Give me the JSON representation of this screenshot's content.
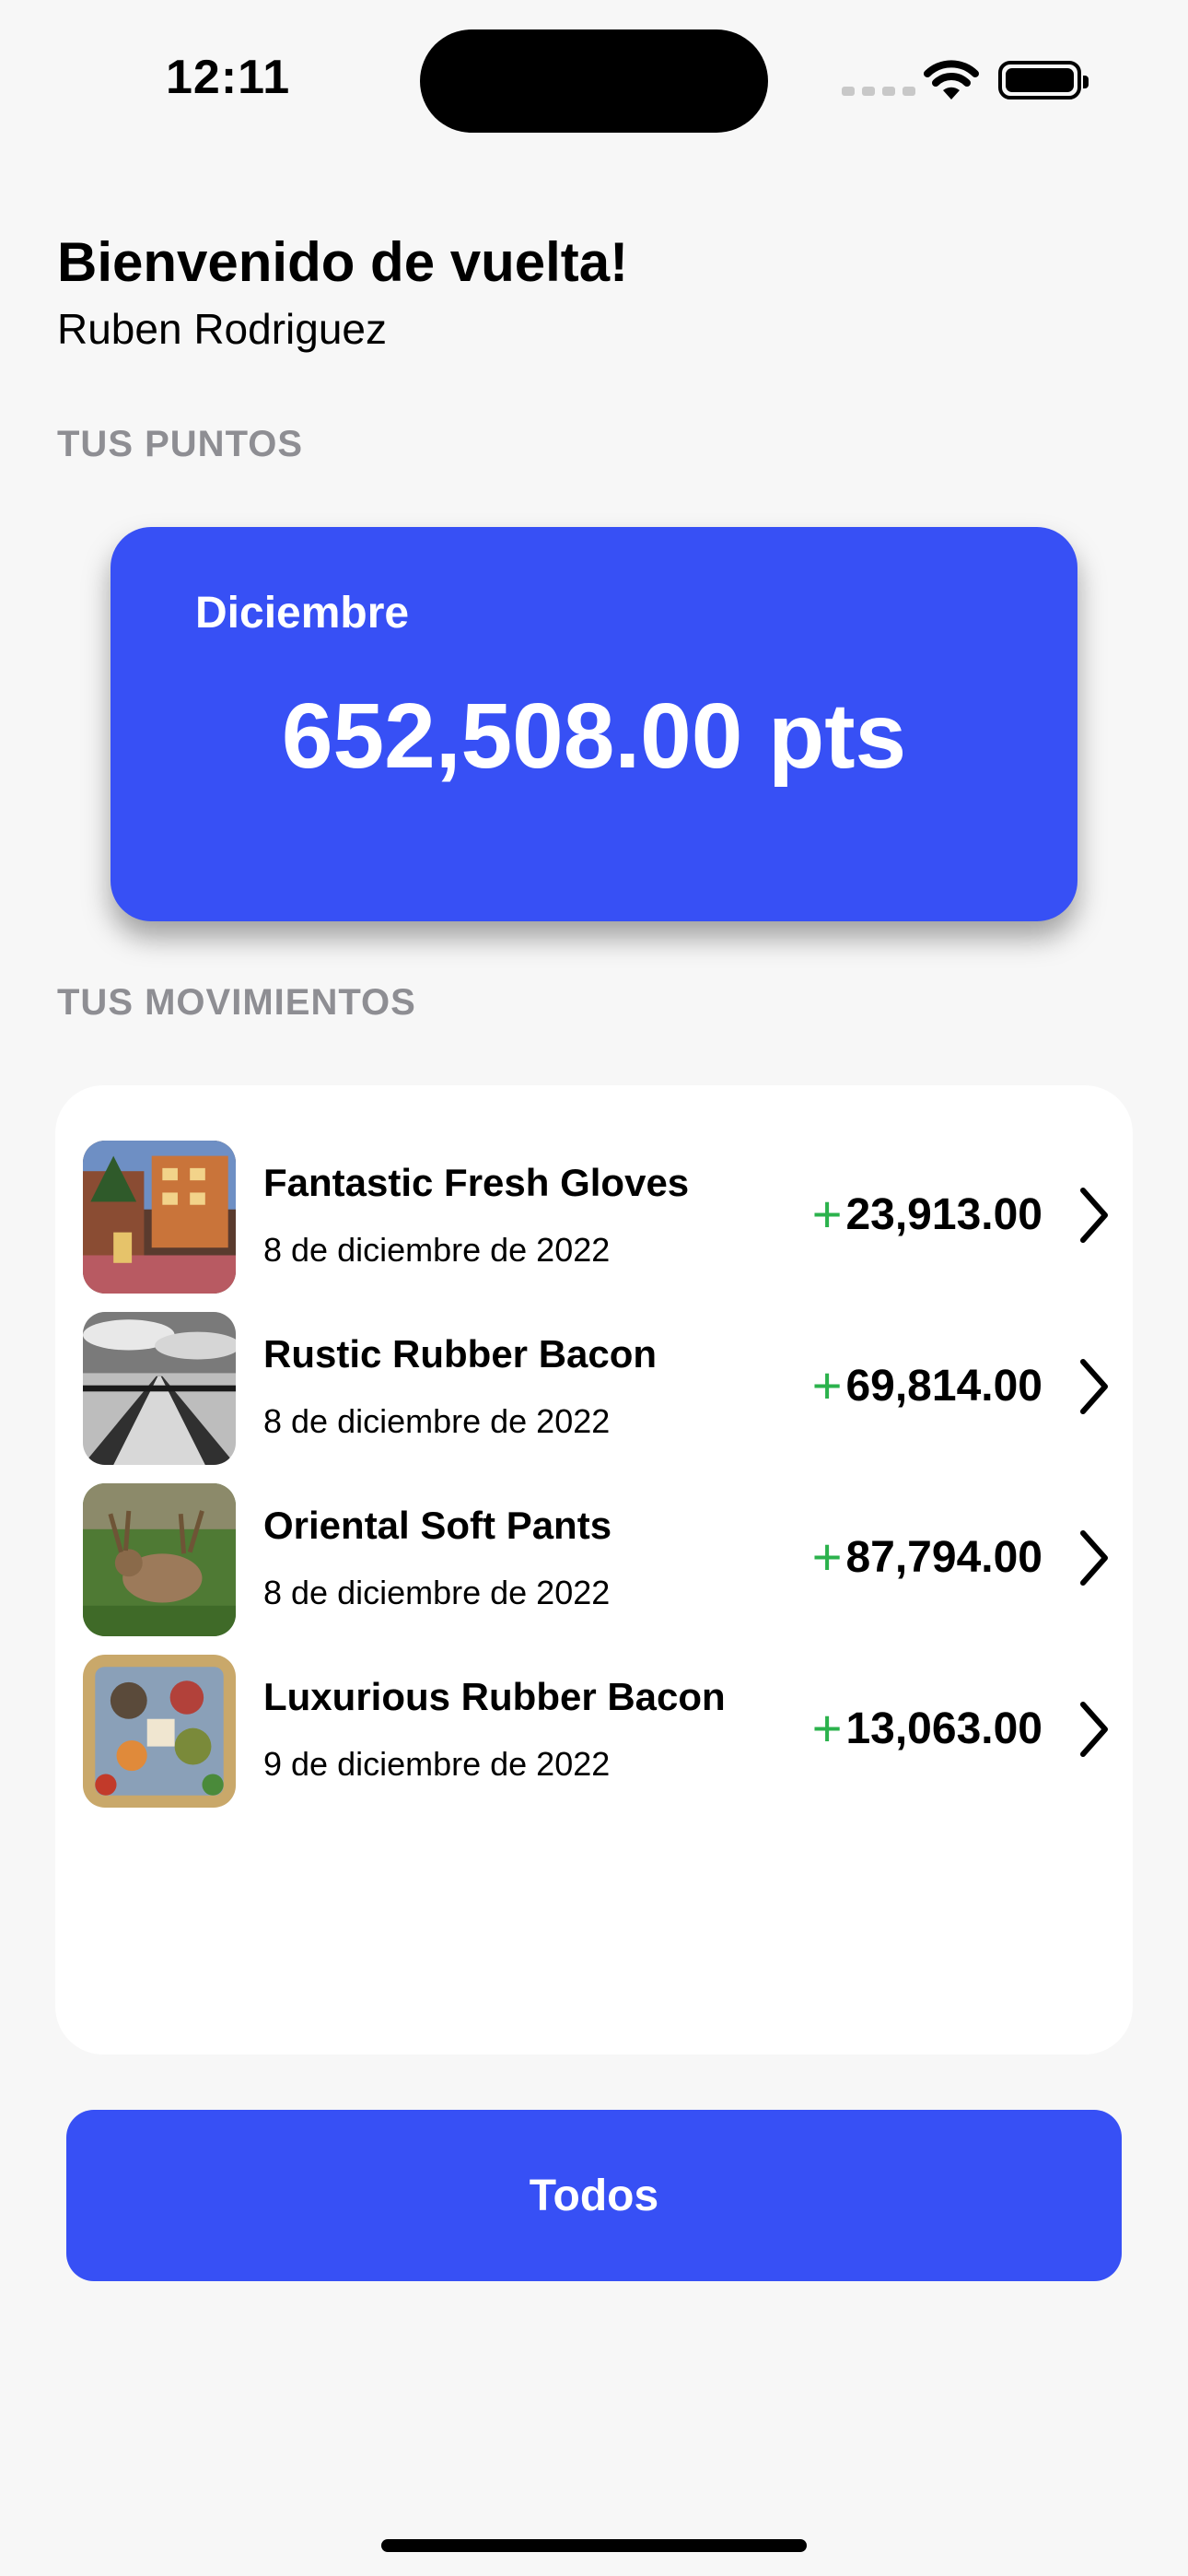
{
  "status_bar": {
    "time": "12:11"
  },
  "header": {
    "welcome": "Bienvenido de vuelta!",
    "user_name": "Ruben Rodriguez"
  },
  "points": {
    "section_label": "TUS PUNTOS",
    "month": "Diciembre",
    "value": "652,508.00 pts"
  },
  "movements": {
    "section_label": "TUS MOVIMIENTOS",
    "items": [
      {
        "title": "Fantastic Fresh Gloves",
        "date": "8 de diciembre de 2022",
        "sign": "+",
        "amount": "23,913.00",
        "image": "hotel-street-photo"
      },
      {
        "title": "Rustic Rubber Bacon",
        "date": "8 de diciembre de 2022",
        "sign": "+",
        "amount": "69,814.00",
        "image": "pier-bw-photo"
      },
      {
        "title": "Oriental Soft Pants",
        "date": "8 de diciembre de 2022",
        "sign": "+",
        "amount": "87,794.00",
        "image": "deer-photo"
      },
      {
        "title": "Luxurious Rubber Bacon",
        "date": "9 de diciembre de 2022",
        "sign": "+",
        "amount": "13,063.00",
        "image": "food-platter-photo"
      }
    ]
  },
  "actions": {
    "all_label": "Todos"
  },
  "colors": {
    "accent": "#3750f5",
    "positive": "#2bb24c",
    "muted": "#8e8e93"
  }
}
